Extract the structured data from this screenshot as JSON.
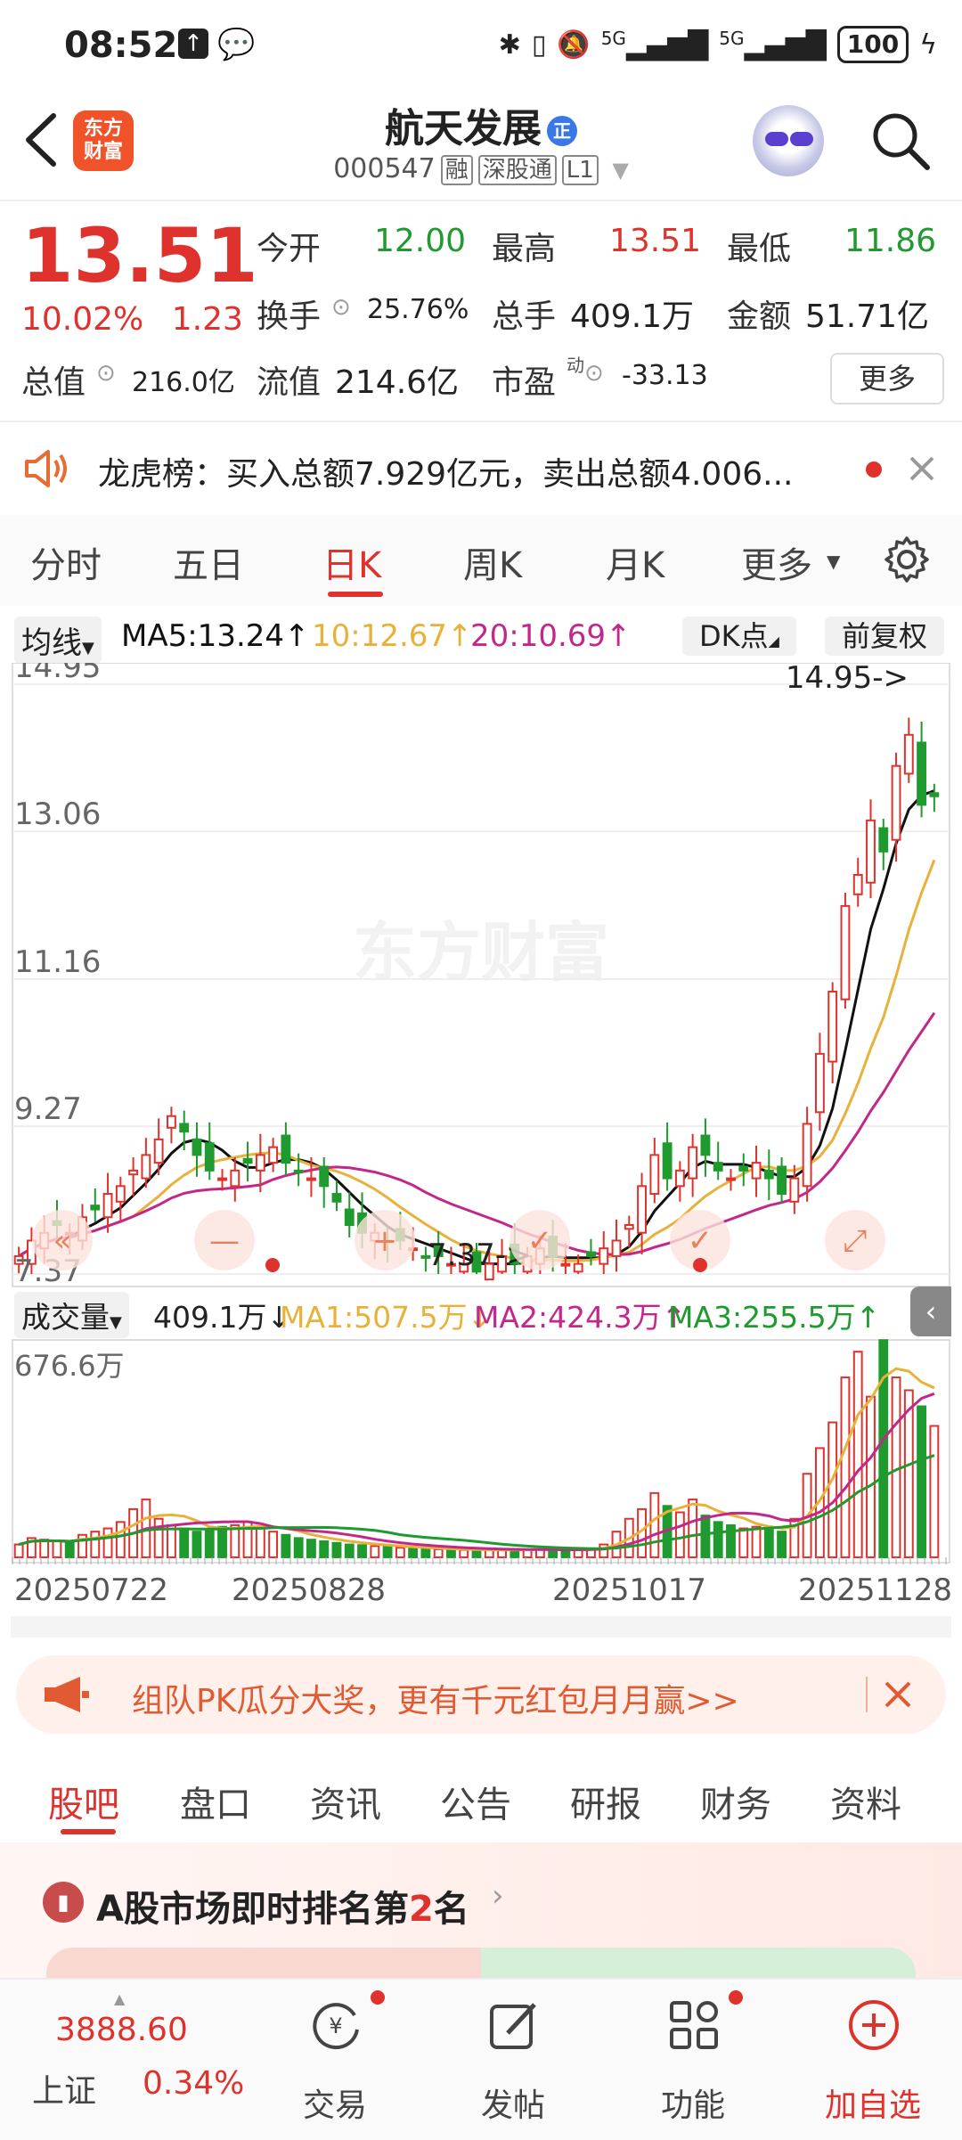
{
  "status_bar": {
    "time": "08:52",
    "network": "5G",
    "network2": "5G",
    "battery": "100"
  },
  "header": {
    "logo_line1": "东方",
    "logo_line2": "财富",
    "stock_name": "航天发展",
    "stock_tag": "正",
    "stock_code": "000547",
    "badge_rong": "融",
    "badge_sgt": "深股通",
    "badge_level": "L1"
  },
  "quote": {
    "price": "13.51",
    "change_pct": "10.02%",
    "change": "1.23",
    "open_label": "今开",
    "open": "12.00",
    "high_label": "最高",
    "high": "13.51",
    "low_label": "最低",
    "low": "11.86",
    "turnover_label": "换手",
    "turnover": "25.76%",
    "volume_label": "总手",
    "volume": "409.1万",
    "amount_label": "金额",
    "amount": "51.71亿",
    "mktcap_label": "总值",
    "mktcap": "216.0亿",
    "float_label": "流值",
    "float": "214.6亿",
    "pe_label": "市盈",
    "pe_sup": "动",
    "pe": "-33.13",
    "more_label": "更多"
  },
  "notice": {
    "text": "龙虎榜：买入总额7.929亿元，卖出总额4.006..."
  },
  "tabs": {
    "items": [
      "分时",
      "五日",
      "日K",
      "周K",
      "月K",
      "更多"
    ],
    "active": "日K"
  },
  "indicators": {
    "ma_label": "均线",
    "ma5": "MA5:13.24↑",
    "ma10": "10:12.67↑",
    "ma20": "20:10.69↑",
    "dk_label": "DK点",
    "fq_label": "前复权"
  },
  "chart_data": {
    "type": "candlestick",
    "y_ticks": [
      "14.95",
      "13.06",
      "11.16",
      "9.27",
      "7.37"
    ],
    "ylim": [
      7.37,
      14.95
    ],
    "annotations": {
      "high": "14.95->",
      "low": "7.37->"
    },
    "watermark": "东方财富",
    "ma_colors": {
      "ma5": "#111111",
      "ma10": "#e8b23a",
      "ma20": "#c2278a"
    },
    "closes": [
      7.6,
      7.8,
      7.9,
      8.0,
      7.9,
      8.1,
      8.2,
      8.4,
      8.5,
      8.7,
      8.9,
      9.1,
      9.4,
      9.2,
      8.9,
      8.7,
      8.6,
      8.7,
      8.8,
      8.9,
      9.0,
      8.8,
      8.7,
      8.6,
      8.5,
      8.3,
      8.0,
      7.9,
      7.9,
      7.8,
      7.8,
      7.7,
      7.6,
      7.6,
      7.5,
      7.5,
      7.4,
      7.5,
      7.6,
      7.5,
      7.6,
      7.7,
      7.6,
      7.5,
      7.5,
      7.6,
      7.7,
      7.8,
      8.0,
      8.5,
      8.9,
      8.6,
      8.7,
      9.0,
      8.9,
      8.7,
      8.6,
      8.7,
      8.8,
      8.6,
      8.4,
      8.6,
      9.3,
      10.2,
      11.0,
      12.1,
      12.5,
      13.2,
      12.8,
      13.9,
      14.3,
      13.4,
      13.51
    ],
    "volume": {
      "label": "成交量",
      "current": "409.1万↓",
      "ma1": "MA1:507.5万↓",
      "ma2": "MA2:424.3万↑",
      "ma3": "MA3:255.5万↑",
      "max_label": "676.6万",
      "ymax": 676.6,
      "values": [
        40,
        60,
        55,
        50,
        45,
        70,
        80,
        90,
        110,
        150,
        180,
        120,
        100,
        90,
        80,
        85,
        95,
        100,
        110,
        90,
        80,
        70,
        60,
        55,
        50,
        45,
        40,
        38,
        35,
        33,
        30,
        28,
        26,
        25,
        24,
        23,
        22,
        22,
        24,
        26,
        25,
        24,
        23,
        22,
        24,
        28,
        40,
        80,
        120,
        150,
        200,
        160,
        140,
        180,
        130,
        110,
        100,
        90,
        95,
        85,
        80,
        120,
        260,
        340,
        420,
        560,
        640,
        500,
        676,
        560,
        520,
        470,
        409
      ],
      "ma_colors": {
        "ma1": "#e8b23a",
        "ma2": "#c2278a",
        "ma3": "#1f9a2e"
      }
    },
    "dates": [
      "20250722",
      "20250828",
      "20251017",
      "20251128"
    ]
  },
  "promo": {
    "text": "组队PK瓜分大奖，更有千元红包月月赢>>"
  },
  "bottom_tabs": {
    "items": [
      "股吧",
      "盘口",
      "资讯",
      "公告",
      "研报",
      "财务",
      "资料"
    ],
    "active": "股吧"
  },
  "rank": {
    "prefix": "A股市场即时排名第",
    "rank": "2",
    "suffix": "名"
  },
  "nav": {
    "index_value": "3888.60",
    "index_name": "上证",
    "index_change": "0.34%",
    "items": [
      "交易",
      "发帖",
      "功能",
      "加自选"
    ]
  },
  "colors": {
    "up": "#e0322d",
    "down": "#1f9a2e",
    "accent": "#e0322d"
  }
}
